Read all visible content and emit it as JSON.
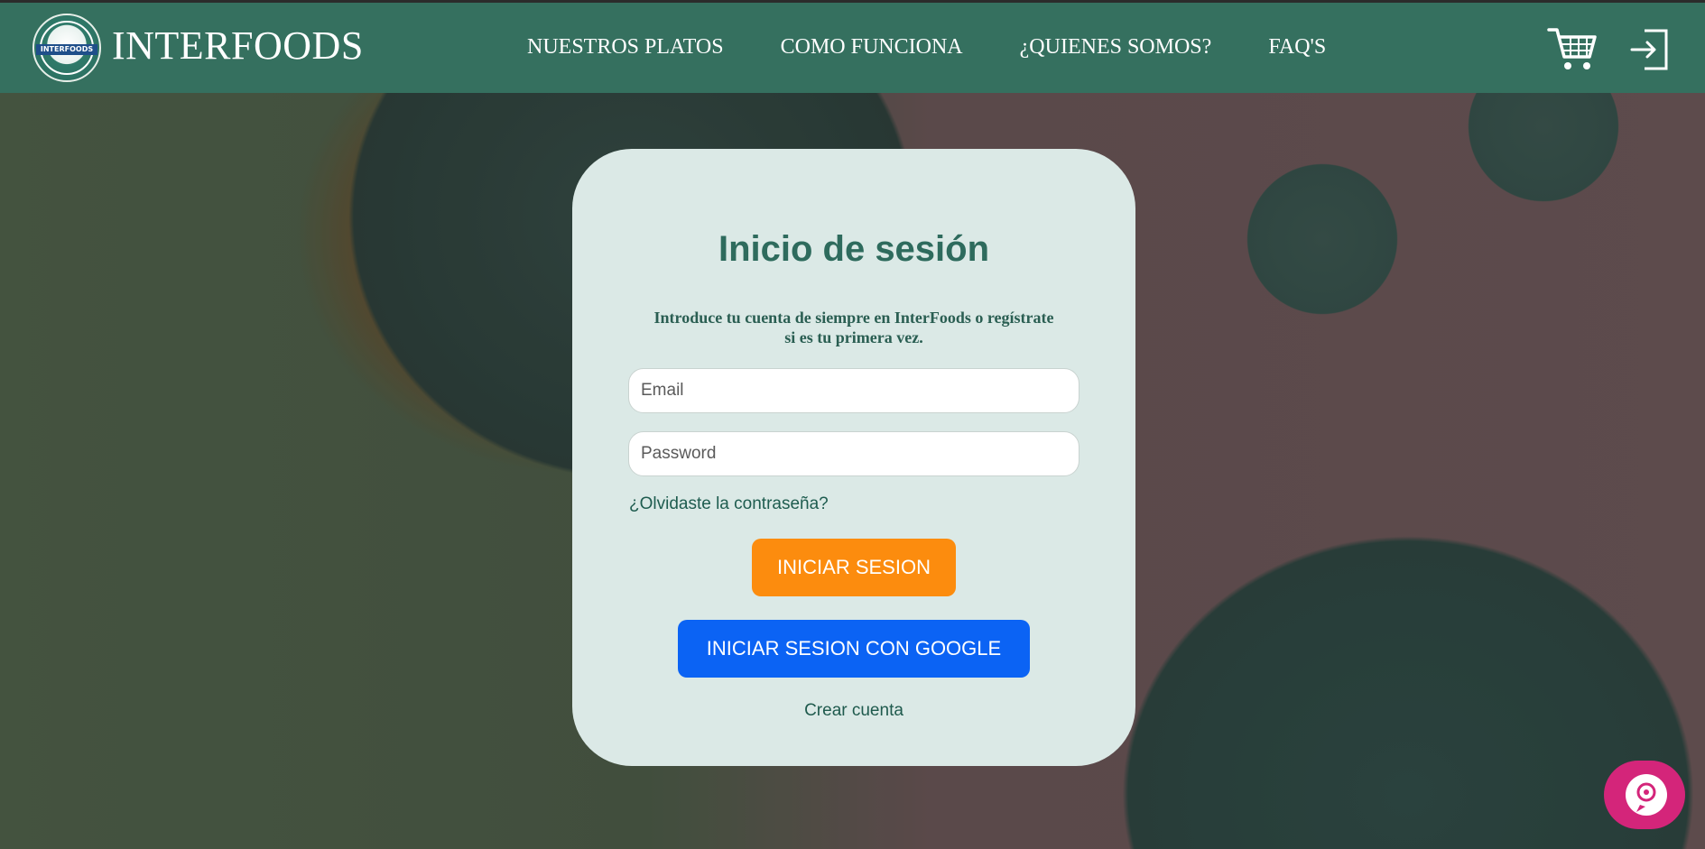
{
  "header": {
    "brand": "INTERFOODS",
    "logo_text": "INTERFOODS",
    "nav": [
      {
        "label": "NUESTROS PLATOS"
      },
      {
        "label": "COMO FUNCIONA"
      },
      {
        "label": "¿QUIENES SOMOS?"
      },
      {
        "label": "FAQ'S"
      }
    ],
    "icons": [
      "cart-icon",
      "login-icon"
    ]
  },
  "login": {
    "title": "Inicio de sesión",
    "intro": "Introduce tu cuenta de siempre en InterFoods o regístrate si es tu primera vez.",
    "email_placeholder": "Email",
    "password_placeholder": "Password",
    "forgot": "¿Olvidaste la contraseña?",
    "login_button": "INICIAR SESION",
    "google_button": "INICIAR SESION CON GOOGLE",
    "create_account": "Crear cuenta"
  },
  "colors": {
    "header": "#35705f",
    "card": "#dbe9e6",
    "title": "#2e6b5d",
    "login_button": "#fc8c0e",
    "google_button": "#0b63f4",
    "chat": "#d4257a"
  },
  "chat": {
    "icon": "chat-bubble-icon"
  }
}
